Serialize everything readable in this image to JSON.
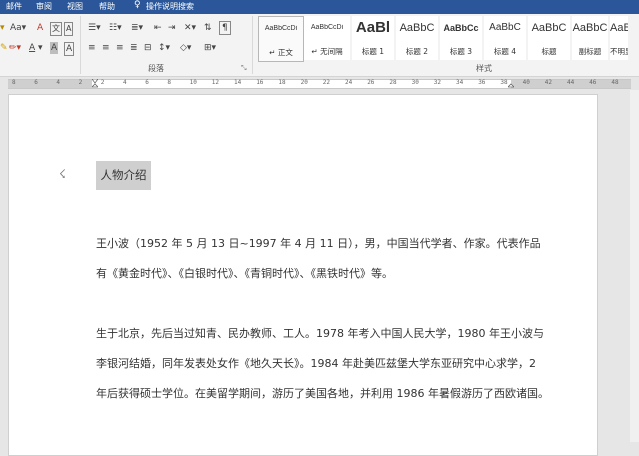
{
  "tabs": [
    {
      "label": "邮件"
    },
    {
      "label": "审阅"
    },
    {
      "label": "视图"
    },
    {
      "label": "帮助"
    }
  ],
  "tell_me": {
    "label": "操作说明搜索",
    "icon": "lightbulb-icon"
  },
  "ribbon": {
    "font": {
      "size_label": "Aa",
      "clear_format": "A",
      "highlight": "A",
      "font_color": "A",
      "char_shading": "A",
      "char_border": "A"
    },
    "paragraph": {
      "group_label": "段落"
    },
    "styles": {
      "group_label": "样式",
      "items": [
        {
          "preview": "AaBbCcDi",
          "name": "↵ 正文"
        },
        {
          "preview": "AaBbCcDi",
          "name": "↵ 无间隔"
        },
        {
          "preview": "AaBl",
          "name": "标题 1"
        },
        {
          "preview": "AaBbC",
          "name": "标题 2"
        },
        {
          "preview": "AaBbCc",
          "name": "标题 3"
        },
        {
          "preview": "AaBbC",
          "name": "标题 4"
        },
        {
          "preview": "AaBbC",
          "name": "标题"
        },
        {
          "preview": "AaBbC",
          "name": "副标题"
        },
        {
          "preview": "AaBbC",
          "name": "不明显"
        }
      ]
    }
  },
  "ruler": {
    "ticks": [
      "8",
      "6",
      "4",
      "2",
      "2",
      "4",
      "6",
      "8",
      "10",
      "12",
      "14",
      "16",
      "18",
      "20",
      "22",
      "24",
      "26",
      "28",
      "30",
      "32",
      "34",
      "36",
      "38",
      "40",
      "42",
      "44",
      "46",
      "48"
    ]
  },
  "document": {
    "heading": "人物介绍",
    "paragraph1": [
      "王小波（1952 年 5 月 13 日~1997 年 4 月 11 日），男，中国当代学者、作家。代表作品",
      "有《黄金时代》、《白银时代》、《青铜时代》、《黑铁时代》等。"
    ],
    "paragraph2": [
      "生于北京，先后当过知青、民办教师、工人。1978 年考入中国人民大学，1980 年王小波与",
      "李银河结婚，同年发表处女作《地久天长》。1984 年赴美匹兹堡大学东亚研究中心求学，2",
      "年后获得硕士学位。在美留学期间，游历了美国各地，并利用 1986 年暑假游历了西欧诸国。"
    ]
  }
}
